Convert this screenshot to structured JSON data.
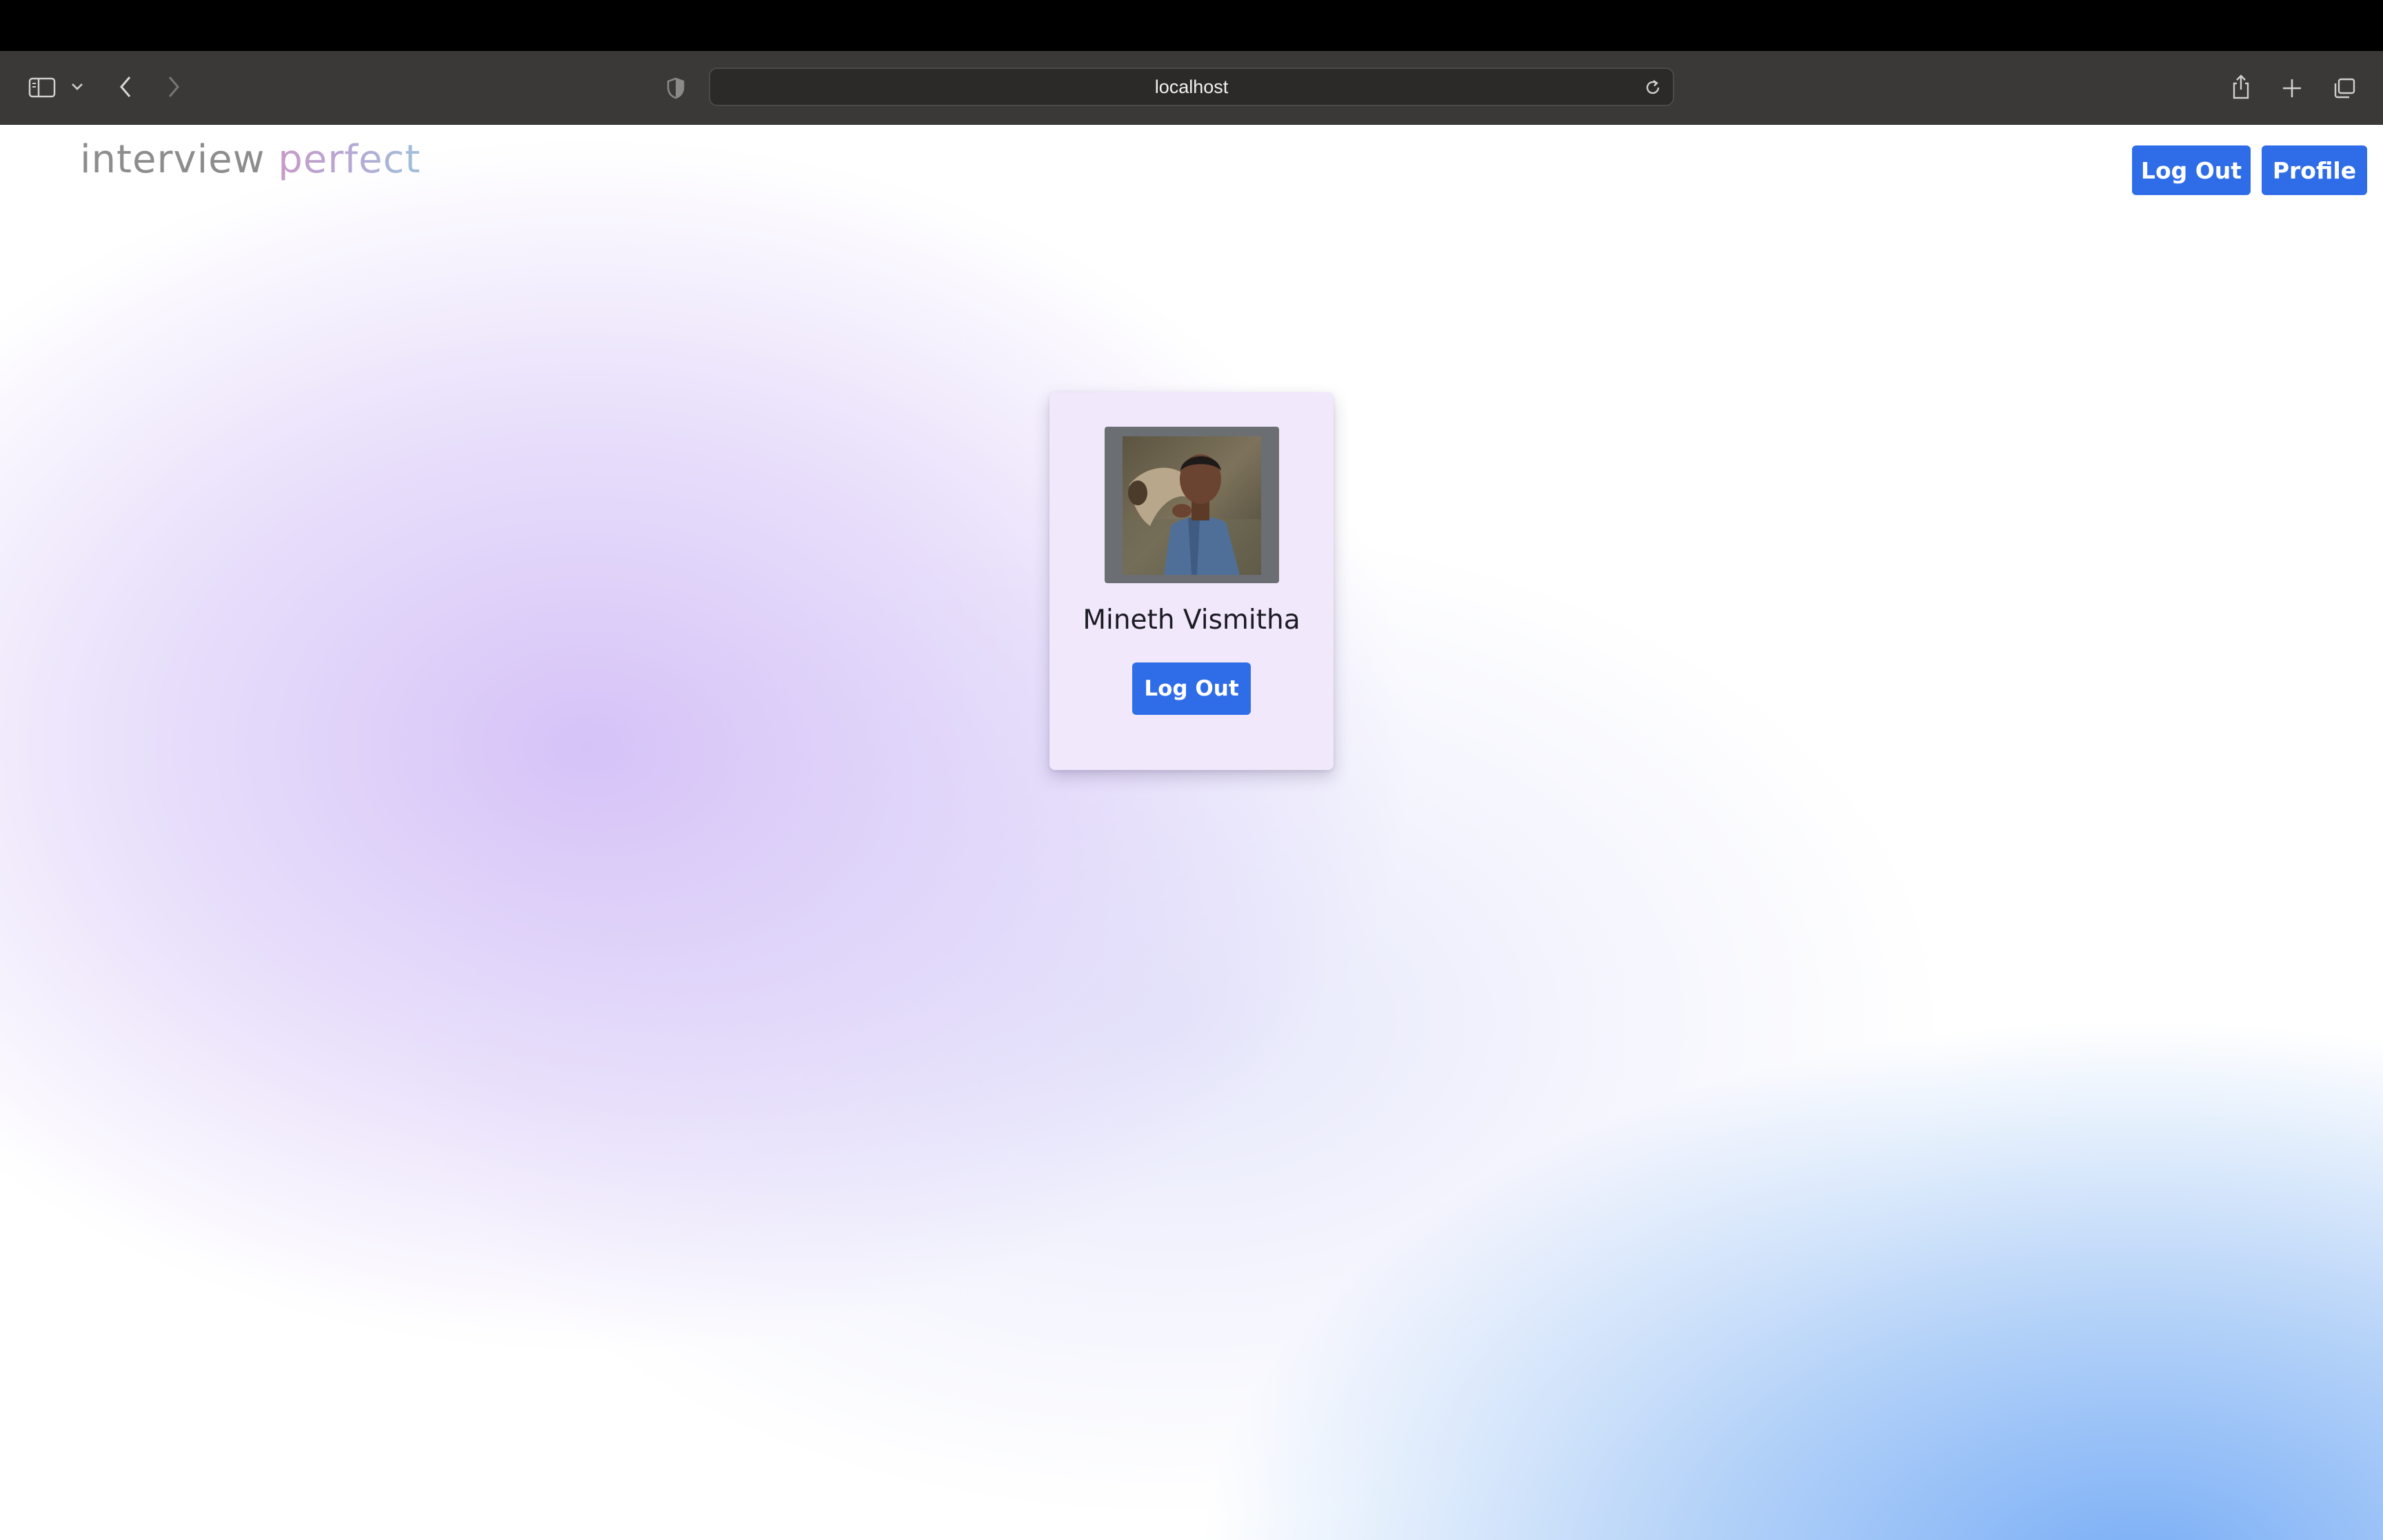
{
  "browser": {
    "url": "localhost",
    "toolbar_icons": [
      "sidebar-icon",
      "chevron-down-icon",
      "back-icon",
      "forward-icon",
      "privacy-shield-icon",
      "reload-icon",
      "share-icon",
      "new-tab-icon",
      "tab-overview-icon"
    ]
  },
  "header": {
    "logo_part1": "interview",
    "logo_part2": "perfect",
    "logout_label": "Log Out",
    "profile_label": "Profile"
  },
  "profile_card": {
    "name": "Mineth Vismitha",
    "logout_label": "Log Out"
  },
  "colors": {
    "primary_button": "#2f6de8",
    "card_background": "#f1e8fb",
    "toolbar": "#3a3937"
  }
}
